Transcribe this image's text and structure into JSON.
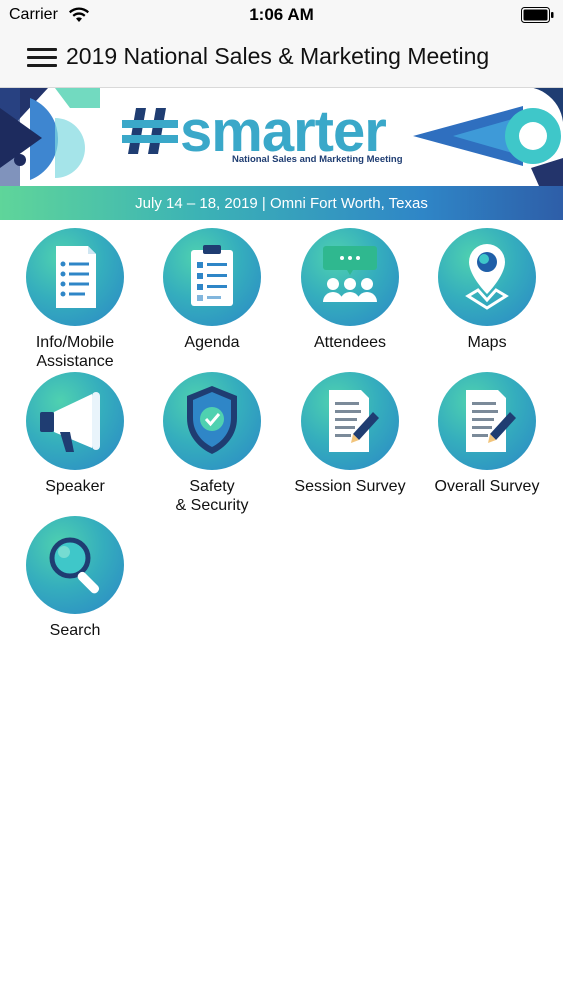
{
  "status_bar": {
    "carrier": "Carrier",
    "time": "1:06 AM"
  },
  "nav": {
    "title": "2019 National Sales & Marketing Meeting"
  },
  "banner": {
    "logo": "smarter",
    "tagline": "National Sales and Marketing Meeting",
    "dates": "July 14 – 18, 2019  |  Omni Fort Worth, Texas"
  },
  "tiles": [
    {
      "label": "Info/Mobile Assistance",
      "icon": "checklist-document-icon"
    },
    {
      "label": "Agenda",
      "icon": "clipboard-icon"
    },
    {
      "label": "Attendees",
      "icon": "people-chat-icon"
    },
    {
      "label": "Maps",
      "icon": "map-pin-icon"
    },
    {
      "label": "Speaker",
      "icon": "megaphone-icon"
    },
    {
      "label": "Safety & Security",
      "icon": "shield-check-icon"
    },
    {
      "label": "Session Survey",
      "icon": "document-pencil-icon"
    },
    {
      "label": "Overall Survey",
      "icon": "document-pencil-icon"
    },
    {
      "label": "Search",
      "icon": "magnifier-icon"
    }
  ],
  "colors": {
    "accent_green": "#4fd1b0",
    "accent_blue": "#2a86c6",
    "brand_navy": "#1f3d72"
  }
}
